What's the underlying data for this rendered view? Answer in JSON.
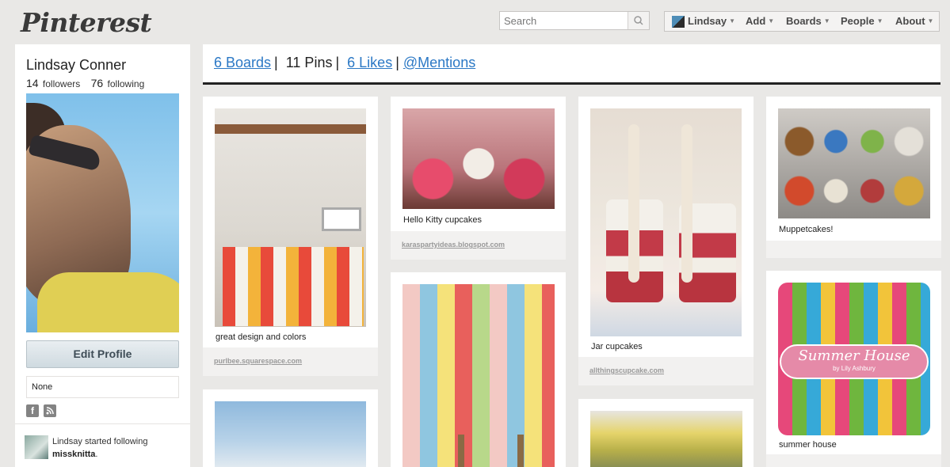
{
  "header": {
    "logo": "Pinterest",
    "search_placeholder": "Search",
    "nav": [
      "Lindsay",
      "Add",
      "Boards",
      "People",
      "About"
    ]
  },
  "sidebar": {
    "name": "Lindsay Conner",
    "followers_count": "14",
    "followers_label": "followers",
    "following_count": "76",
    "following_label": "following",
    "edit_profile": "Edit Profile",
    "location": "None",
    "activity_prefix": "Lindsay started following",
    "activity_user": "missknitta",
    "activity_suffix": "."
  },
  "tabs": {
    "boards": "6 Boards",
    "pins": "11 Pins",
    "likes": "6 Likes",
    "mentions": "@Mentions"
  },
  "pins": [
    {
      "desc": "great design and colors",
      "source": "purlbee.squarespace.com"
    },
    {
      "desc": "Hello Kitty cupcakes",
      "source": "karaspartyideas.blogspot.com"
    },
    {
      "desc": "Jar cupcakes",
      "source": "allthingscupcake.com"
    },
    {
      "desc": "Muppetcakes!",
      "source": ""
    },
    {
      "desc": "summer house",
      "source": ""
    }
  ],
  "fabric_text": {
    "title": "Summer House",
    "subtitle": "by Lily Ashbury"
  }
}
